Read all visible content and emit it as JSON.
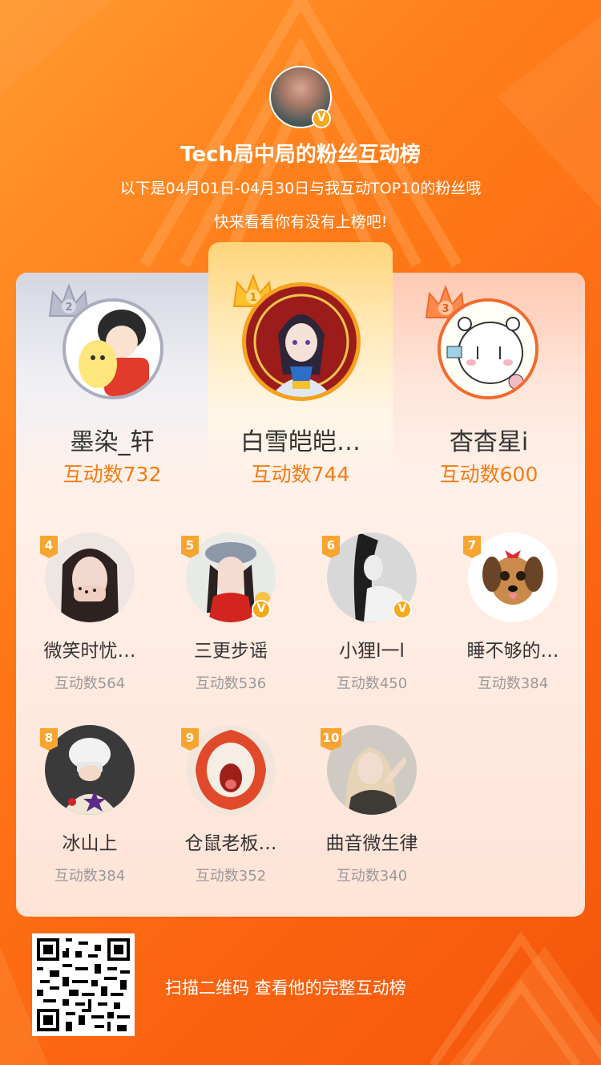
{
  "owner": {
    "title": "Tech局中局的粉丝互动榜",
    "subtitle1": "以下是04月01日-04月30日与我互动TOP10的粉丝哦",
    "subtitle2": "快来看看你有没有上榜吧!",
    "verified_badge": "V"
  },
  "podium": [
    {
      "rank": "2",
      "name": "墨染_轩",
      "count": "互动数732"
    },
    {
      "rank": "1",
      "name": "白雪皑皑…",
      "count": "互动数744"
    },
    {
      "rank": "3",
      "name": "杳杳星i",
      "count": "互动数600"
    }
  ],
  "fans": [
    {
      "rank": "4",
      "name": "微笑时忧…",
      "count": "互动数564"
    },
    {
      "rank": "5",
      "name": "三更步谣",
      "count": "互动数536"
    },
    {
      "rank": "6",
      "name": "小狸l一l",
      "count": "互动数450"
    },
    {
      "rank": "7",
      "name": "睡不够的…",
      "count": "互动数384"
    },
    {
      "rank": "8",
      "name": "冰山上",
      "count": "互动数384"
    },
    {
      "rank": "9",
      "name": "仓鼠老板…",
      "count": "互动数352"
    },
    {
      "rank": "10",
      "name": "曲音微生律",
      "count": "互动数340"
    }
  ],
  "footer": {
    "text": "扫描二维码 查看他的完整互动榜"
  },
  "colors": {
    "accent": "#f57c14",
    "badge": "#f7a530",
    "background": "#ff7a18"
  }
}
